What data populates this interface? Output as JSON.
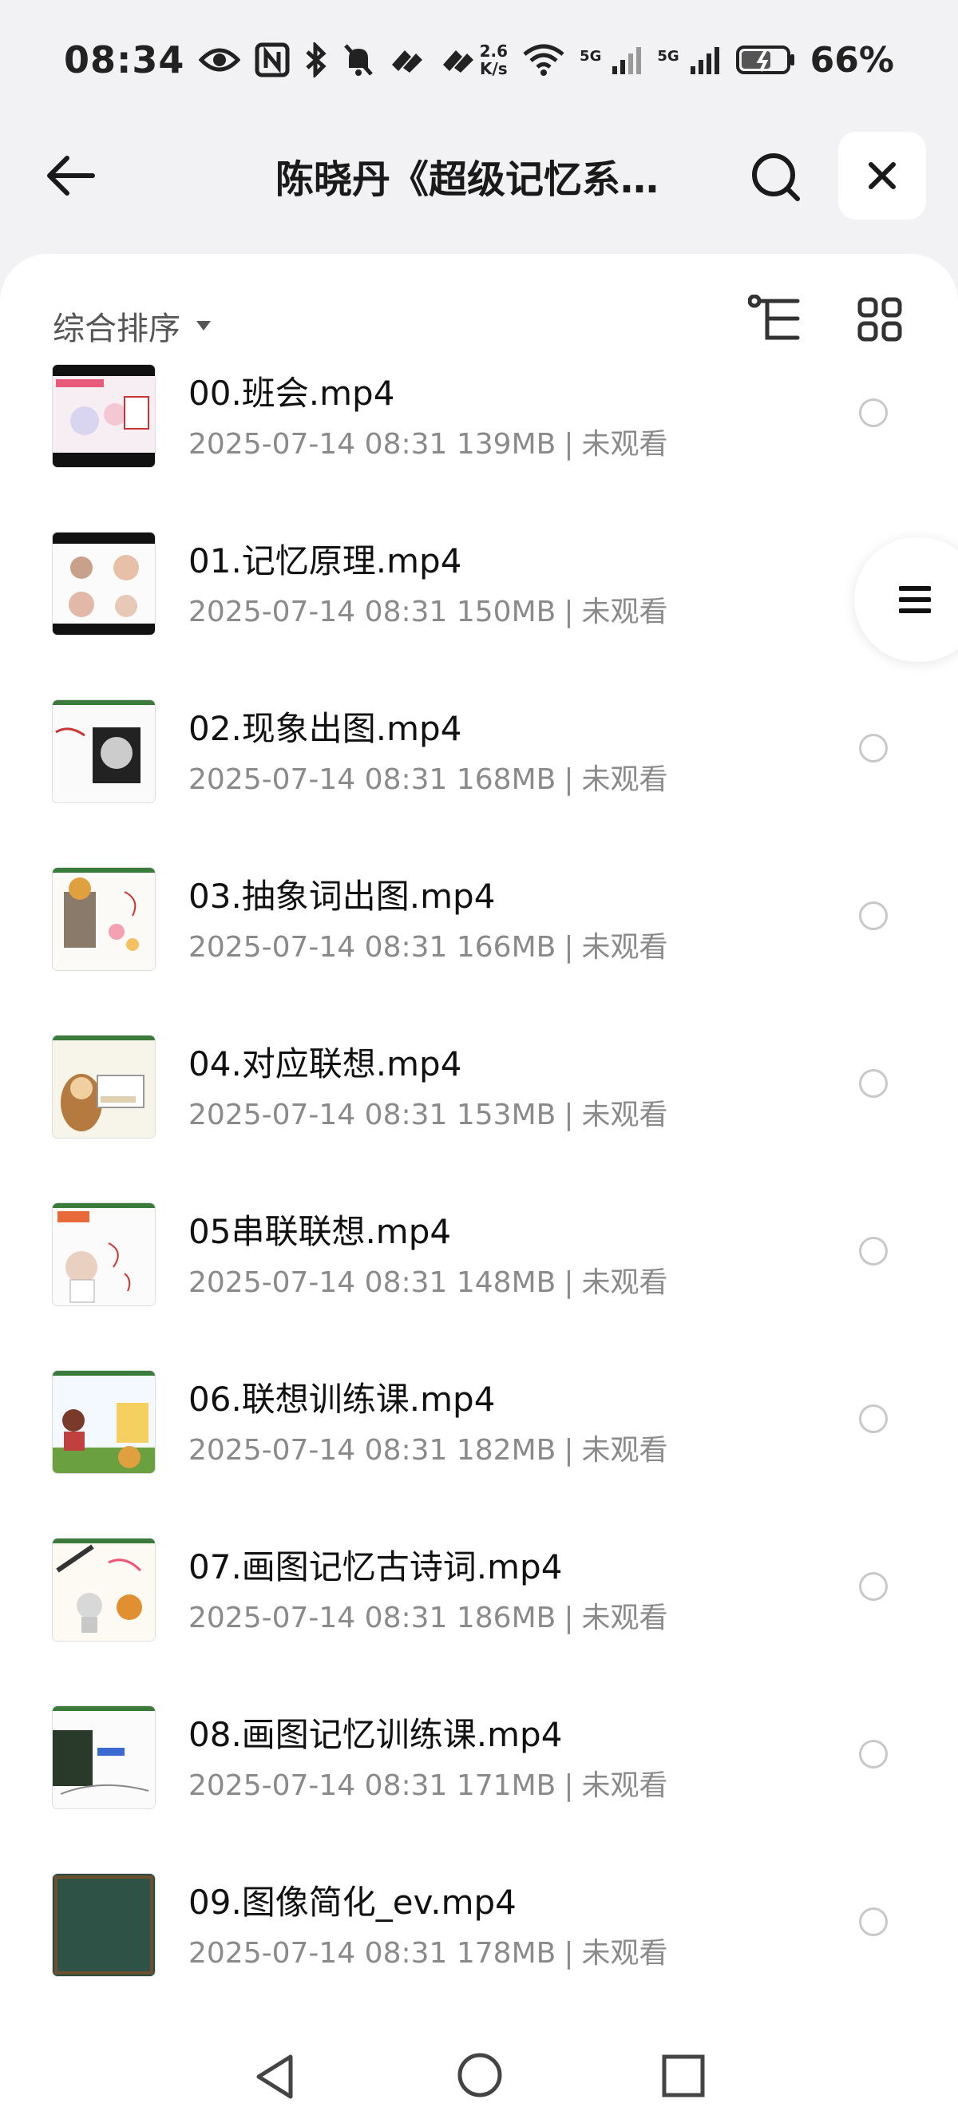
{
  "status": {
    "time": "08:34",
    "net_speed_top": "2.6",
    "net_speed_bottom": "K/s",
    "sig1_label": "5G",
    "sig2_label": "5G",
    "battery": "66%"
  },
  "header": {
    "title": "陈晓丹《超级记忆系…"
  },
  "toolbar": {
    "sort_label": "综合排序"
  },
  "files": [
    {
      "name": "00.班会.mp4",
      "date": "2025-07-14 08:31",
      "size": "139MB",
      "status": "未观看"
    },
    {
      "name": "01.记忆原理.mp4",
      "date": "2025-07-14 08:31",
      "size": "150MB",
      "status": "未观看"
    },
    {
      "name": "02.现象出图.mp4",
      "date": "2025-07-14 08:31",
      "size": "168MB",
      "status": "未观看"
    },
    {
      "name": "03.抽象词出图.mp4",
      "date": "2025-07-14 08:31",
      "size": "166MB",
      "status": "未观看"
    },
    {
      "name": "04.对应联想.mp4",
      "date": "2025-07-14 08:31",
      "size": "153MB",
      "status": "未观看"
    },
    {
      "name": "05串联联想.mp4",
      "date": "2025-07-14 08:31",
      "size": "148MB",
      "status": "未观看"
    },
    {
      "name": "06.联想训练课.mp4",
      "date": "2025-07-14 08:31",
      "size": "182MB",
      "status": "未观看"
    },
    {
      "name": "07.画图记忆古诗词.mp4",
      "date": "2025-07-14 08:31",
      "size": "186MB",
      "status": "未观看"
    },
    {
      "name": "08.画图记忆训练课.mp4",
      "date": "2025-07-14 08:31",
      "size": "171MB",
      "status": "未观看"
    },
    {
      "name": "09.图像简化_ev.mp4",
      "date": "2025-07-14 08:31",
      "size": "178MB",
      "status": "未观看"
    }
  ],
  "meta_separator": "|",
  "colors": {
    "background": "#f2f2f4",
    "panel": "#ffffff",
    "meta_text": "#8a8a8a",
    "radio_border": "#c8c8c8"
  },
  "icons": [
    "back-arrow-icon",
    "search-icon",
    "close-icon",
    "sort-caret-icon",
    "tree-view-icon",
    "grid-view-icon",
    "menu-icon",
    "nav-back-icon",
    "nav-home-icon",
    "nav-recent-icon"
  ]
}
